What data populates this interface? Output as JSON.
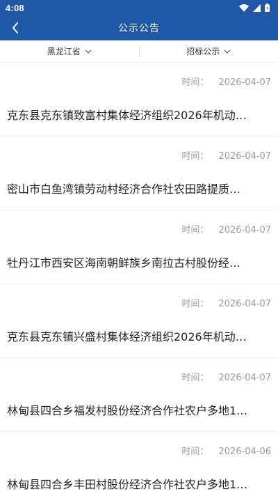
{
  "status_bar": {
    "time": "4:08"
  },
  "app_bar": {
    "title": "公示公告"
  },
  "filters": [
    {
      "label": "黑龙江省"
    },
    {
      "label": "招标公示"
    }
  ],
  "list": {
    "time_label": "时间：",
    "items": [
      {
        "date": "2026-04-07",
        "title": "克东县克东镇致富村集体经济组织2026年机动…"
      },
      {
        "date": "2026-04-07",
        "title": "密山市白鱼湾镇劳动村经济合作社农田路提质…"
      },
      {
        "date": "2026-04-07",
        "title": "牡丹江市西安区海南朝鲜族乡南拉古村股份经…"
      },
      {
        "date": "2026-04-07",
        "title": "克东县克东镇兴盛村集体经济组织2026年机动…"
      },
      {
        "date": "2026-04-07",
        "title": "林甸县四合乡福发村股份经济合作社农户多地1…"
      },
      {
        "date": "2026-04-06",
        "title": "林甸县四合乡丰田村股份经济合作社农户多地1…"
      }
    ]
  },
  "colors": {
    "primary": "#1e58a6",
    "time_text": "#9a9a9a",
    "title_text": "#222222"
  }
}
